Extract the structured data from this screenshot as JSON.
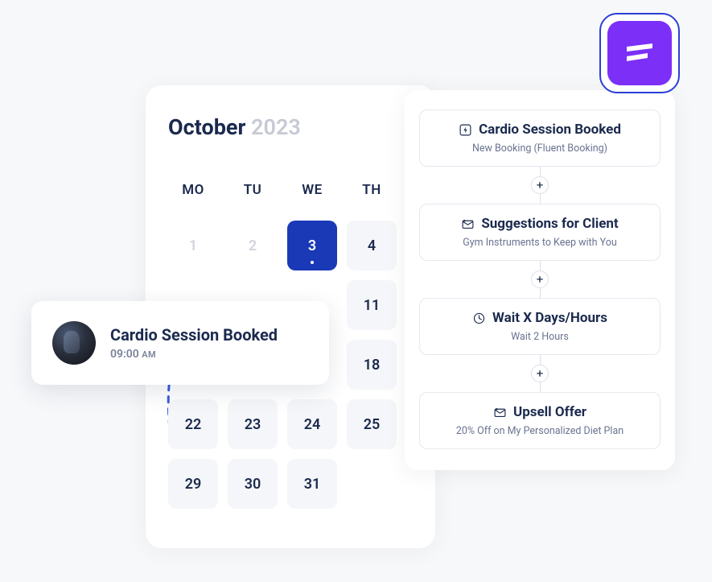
{
  "calendar": {
    "month": "October",
    "year": "2023",
    "weekdays": [
      "MO",
      "TU",
      "WE",
      "TH"
    ],
    "dates": [
      {
        "d": "1",
        "muted": true
      },
      {
        "d": "2",
        "muted": true
      },
      {
        "d": "3",
        "selected": true
      },
      {
        "d": "4"
      },
      {
        "d": ""
      },
      {
        "d": ""
      },
      {
        "d": ""
      },
      {
        "d": "11"
      },
      {
        "d": ""
      },
      {
        "d": ""
      },
      {
        "d": ""
      },
      {
        "d": "18"
      },
      {
        "d": "22"
      },
      {
        "d": "23"
      },
      {
        "d": "24"
      },
      {
        "d": "25"
      },
      {
        "d": "29"
      },
      {
        "d": "30"
      },
      {
        "d": "31"
      }
    ]
  },
  "event": {
    "title": "Cardio Session Booked",
    "time": "09:00",
    "ampm": "AM"
  },
  "workflow": {
    "steps": [
      {
        "icon": "bolt",
        "title": "Cardio Session Booked",
        "sub": "New Booking (Fluent Booking)"
      },
      {
        "icon": "mail",
        "title": "Suggestions for Client",
        "sub": "Gym Instruments to Keep with You"
      },
      {
        "icon": "clock",
        "title": "Wait X Days/Hours",
        "sub": "Wait 2 Hours"
      },
      {
        "icon": "mail",
        "title": "Upsell Offer",
        "sub": "20% Off on My Personalized Diet Plan"
      }
    ]
  },
  "colors": {
    "accent": "#1939b7",
    "brand": "#7b2ff7"
  }
}
